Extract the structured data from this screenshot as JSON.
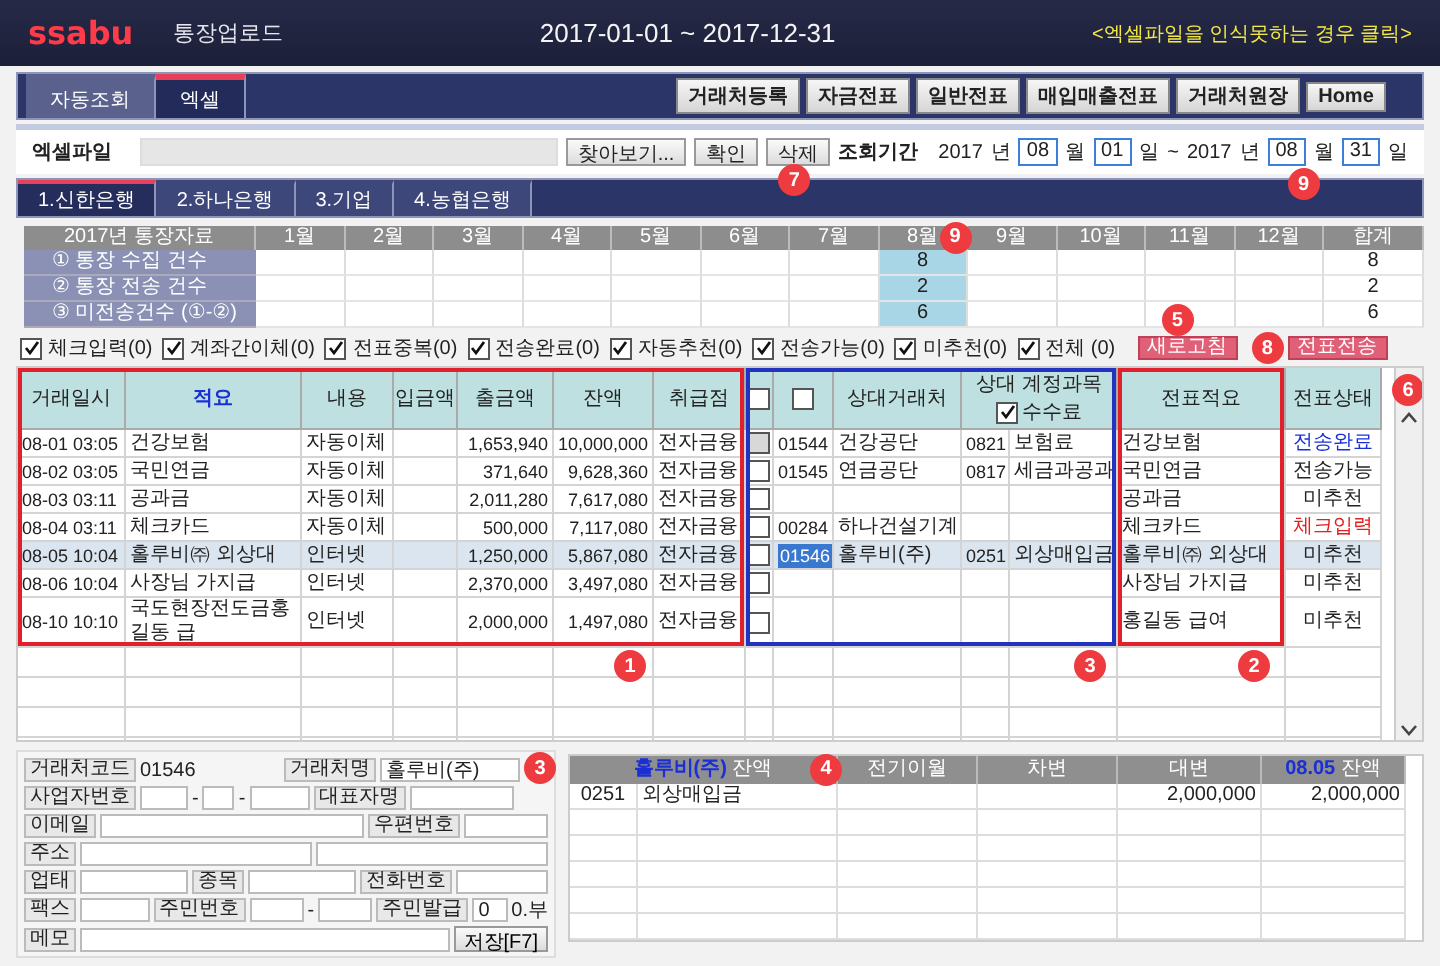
{
  "header": {
    "logo": "ssabu",
    "title": "통장업로드",
    "period": "2017-01-01 ~ 2017-12-31",
    "help_link": "<엑셀파일을 인식못하는 경우 클릭>"
  },
  "tabs": [
    {
      "label": "자동조회",
      "selected": false
    },
    {
      "label": "엑셀",
      "selected": true
    }
  ],
  "toolbar_buttons": [
    "거래처등록",
    "자금전표",
    "일반전표",
    "매입매출전표",
    "거래처원장",
    "Home"
  ],
  "file_row": {
    "label": "엑셀파일",
    "browse": "찾아보기...",
    "confirm": "확인",
    "delete": "삭제",
    "delete_badge": "7",
    "period_label": "조회기간",
    "separator": "~",
    "from": {
      "year": "2017",
      "year_unit": "년",
      "month": "08",
      "month_unit": "월",
      "day": "01",
      "day_unit": "일"
    },
    "to": {
      "year": "2017",
      "year_unit": "년",
      "month": "08",
      "month_unit": "월",
      "day": "31",
      "day_unit": "일",
      "badge": "9"
    }
  },
  "bank_tabs": [
    {
      "label": "1.신한은행",
      "selected": true
    },
    {
      "label": "2.하나은행",
      "selected": false
    },
    {
      "label": "3.기업",
      "selected": false
    },
    {
      "label": "4.농협은행",
      "selected": false
    }
  ],
  "summary": {
    "corner": "2017년 통장자료",
    "row_labels": [
      "① 통장 수집 건수",
      "② 통장 전송 건수",
      "③ 미전송건수 (①-②)"
    ],
    "months": [
      {
        "label": "1월",
        "selected": false
      },
      {
        "label": "2월",
        "selected": false
      },
      {
        "label": "3월",
        "selected": false
      },
      {
        "label": "4월",
        "selected": false
      },
      {
        "label": "5월",
        "selected": false
      },
      {
        "label": "6월",
        "selected": false
      },
      {
        "label": "7월",
        "selected": false
      },
      {
        "label": "8월",
        "selected": true,
        "badge": "9",
        "counts": [
          "8",
          "2",
          "6"
        ]
      },
      {
        "label": "9월",
        "selected": false
      },
      {
        "label": "10월",
        "selected": false
      },
      {
        "label": "11월",
        "selected": false
      },
      {
        "label": "12월",
        "selected": false
      }
    ],
    "total": {
      "label": "합계",
      "counts": [
        "8",
        "2",
        "6"
      ]
    }
  },
  "filters": [
    {
      "label": "체크입력(0)",
      "checked": true
    },
    {
      "label": "계좌간이체(0)",
      "checked": true
    },
    {
      "label": "전표중복(0)",
      "checked": true
    },
    {
      "label": "전송완료(0)",
      "checked": true
    },
    {
      "label": "자동추천(0)",
      "checked": true
    },
    {
      "label": "전송가능(0)",
      "checked": true
    },
    {
      "label": "미추천(0)",
      "checked": true
    },
    {
      "label": "전체 (0)",
      "checked": true
    }
  ],
  "action_buttons": [
    {
      "label": "새로고침",
      "badge": "5"
    },
    {
      "label": "전표전송",
      "badge": "8"
    }
  ],
  "grid": {
    "columns": [
      "거래일시",
      "적요",
      "내용",
      "입금액",
      "출금액",
      "잔액",
      "취급점"
    ],
    "select_all": false,
    "select_all_2": false,
    "partner_header": "상대거래처",
    "account_header": "상대 계정과목",
    "fee": {
      "label": "수수료",
      "checked": true
    },
    "memo_header": "전표적요",
    "status_header": "전표상태",
    "status_badge": "6",
    "left_badge": "1",
    "partner_badge": "3",
    "memo_badge": "2",
    "rows": [
      {
        "date": "08-01 03:05",
        "summary": "건강보험",
        "content": "자동이체",
        "withdrawal": "1,653,940",
        "balance": "10,000,000",
        "branch": "전자금융",
        "checked": false,
        "disabled": true,
        "partner_code": "01544",
        "partner_name": "건강공단",
        "account_code": "0821",
        "account_name": "보험료",
        "memo": "건강보험",
        "status": "전송완료",
        "color": "#1a2fd6",
        "selected": false
      },
      {
        "date": "08-02 03:05",
        "summary": "국민연금",
        "content": "자동이체",
        "withdrawal": "371,640",
        "balance": "9,628,360",
        "branch": "전자금융",
        "checked": false,
        "disabled": false,
        "partner_code": "01545",
        "partner_name": "연금공단",
        "account_code": "0817",
        "account_name": "세금과공과",
        "memo": "국민연금",
        "status": "전송가능",
        "color": "#222222",
        "selected": false
      },
      {
        "date": "08-03 03:11",
        "summary": "공과금",
        "content": "자동이체",
        "withdrawal": "2,011,280",
        "balance": "7,617,080",
        "branch": "전자금융",
        "checked": false,
        "disabled": false,
        "memo": "공과금",
        "status": "미추천",
        "color": "#222222",
        "selected": false
      },
      {
        "date": "08-04 03:11",
        "summary": "체크카드",
        "content": "자동이체",
        "withdrawal": "500,000",
        "balance": "7,117,080",
        "branch": "전자금융",
        "checked": false,
        "disabled": false,
        "partner_code": "00284",
        "partner_name": "하나건설기계",
        "memo": "체크카드",
        "status": "체크입력",
        "color": "#e02020",
        "selected": false
      },
      {
        "date": "08-05 10:04",
        "summary": "홀루비㈜ 외상대",
        "content": "인터넷",
        "withdrawal": "1,250,000",
        "balance": "5,867,080",
        "branch": "전자금융",
        "checked": false,
        "disabled": false,
        "partner_code": "01546",
        "partner_name": "홀루비(주)",
        "account_code": "0251",
        "account_name": "외상매입금",
        "memo": "홀루비㈜ 외상대",
        "status": "미추천",
        "color": "#222222",
        "selected": true
      },
      {
        "date": "08-06 10:04",
        "summary": "사장님 가지급",
        "content": "인터넷",
        "withdrawal": "2,370,000",
        "balance": "3,497,080",
        "branch": "전자금융",
        "checked": false,
        "disabled": false,
        "memo": "사장님 가지급",
        "status": "미추천",
        "color": "#222222",
        "selected": false
      },
      {
        "date": "08-10 10:10",
        "summary": "국도현장전도금홍길동 급",
        "content": "인터넷",
        "withdrawal": "2,000,000",
        "balance": "1,497,080",
        "branch": "전자금융",
        "checked": false,
        "disabled": false,
        "memo": "홍길동 급여",
        "status": "미추천",
        "color": "#222222",
        "selected": false
      }
    ]
  },
  "partner_form": {
    "code_label": "거래처코드",
    "code": "01546",
    "name_label": "거래처명",
    "name": "홀루비(주)",
    "name_badge": "3",
    "biz_label": "사업자번호",
    "biz_separators": [
      "-",
      "-"
    ],
    "ceo_label": "대표자명",
    "email_label": "이메일",
    "zip_label": "우편번호",
    "address_label": "주소",
    "business_label": "업태",
    "item_label": "종목",
    "phone_label": "전화번호",
    "fax_label": "팩스",
    "resident_label": "주민번호",
    "resident_separator": "-",
    "issue_label": "주민발급",
    "issue_value": "0",
    "issue_suffix": "0.부",
    "memo_label": "메모",
    "save": "저장[F7]"
  },
  "ledger": {
    "holder": "홀루비(주)",
    "holder_suffix": "잔액",
    "badge": "4",
    "columns": [
      "전기이월",
      "차변",
      "대변"
    ],
    "date": "08.05",
    "date_suffix": "잔액",
    "rows": [
      {
        "code": "0251",
        "name": "외상매입금",
        "credit": "2,000,000",
        "balance": "2,000,000"
      }
    ]
  }
}
